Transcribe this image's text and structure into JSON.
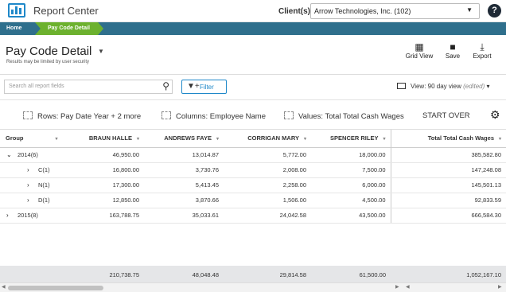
{
  "app": {
    "title": "Report Center",
    "client_label": "Client(s)",
    "client_value": "Arrow Technologies, Inc. (102)",
    "help": "?"
  },
  "breadcrumb": {
    "home": "Home",
    "current": "Pay Code Detail"
  },
  "header": {
    "title": "Pay Code Detail",
    "subtitle": "Results may be limited by user security",
    "tools": {
      "grid_view": "Grid View",
      "save": "Save",
      "export": "Export"
    }
  },
  "filters": {
    "search_placeholder": "Search all report fields",
    "filter_label": "Filter",
    "view_label": "View: 90 day view",
    "view_note": "(edited)"
  },
  "pivot": {
    "rows": "Rows: Pay Date Year + 2 more",
    "columns": "Columns: Employee Name",
    "values": "Values: Total Total Cash Wages",
    "start_over": "START OVER"
  },
  "table": {
    "headers": {
      "group": "Group",
      "c1": "BRAUN HALLE",
      "c2": "ANDREWS FAYE",
      "c3": "CORRIGAN MARY",
      "c4": "SPENCER RILEY",
      "total": "Total Total Cash Wages"
    },
    "rows": [
      {
        "toggle": "⌄",
        "label": "2014",
        "count": "(6)",
        "c1": "46,950.00",
        "c2": "13,014.87",
        "c3": "5,772.00",
        "c4": "18,000.00",
        "total": "385,582.80"
      },
      {
        "toggle": "›",
        "label": "C",
        "count": "(1)",
        "c1": "16,800.00",
        "c2": "3,730.76",
        "c3": "2,008.00",
        "c4": "7,500.00",
        "total": "147,248.08"
      },
      {
        "toggle": "›",
        "label": "N",
        "count": "(1)",
        "c1": "17,300.00",
        "c2": "5,413.45",
        "c3": "2,258.00",
        "c4": "6,000.00",
        "total": "145,501.13"
      },
      {
        "toggle": "›",
        "label": "D",
        "count": "(1)",
        "c1": "12,850.00",
        "c2": "3,870.66",
        "c3": "1,506.00",
        "c4": "4,500.00",
        "total": "92,833.59"
      },
      {
        "toggle": "›",
        "label": "2015",
        "count": "(8)",
        "c1": "163,788.75",
        "c2": "35,033.61",
        "c3": "24,042.58",
        "c4": "43,500.00",
        "total": "666,584.30"
      }
    ],
    "totals": {
      "c1": "210,738.75",
      "c2": "48,048.48",
      "c3": "29,814.58",
      "c4": "61,500.00",
      "total": "1,052,167.10"
    }
  },
  "colors": {
    "brand": "#1f88c9",
    "crumb_bar": "#2f6f8c",
    "crumb_active": "#6cb12e",
    "totals_bg": "#e5e6e8"
  },
  "icons": [
    "logo-icon",
    "dropdown-caret-icon",
    "help-icon",
    "grid-icon",
    "save-icon",
    "export-icon",
    "search-icon",
    "filter-plus-icon",
    "monitor-icon",
    "rows-icon",
    "columns-icon",
    "values-icon",
    "gear-icon",
    "sort-caret-icon",
    "expand-icon"
  ]
}
